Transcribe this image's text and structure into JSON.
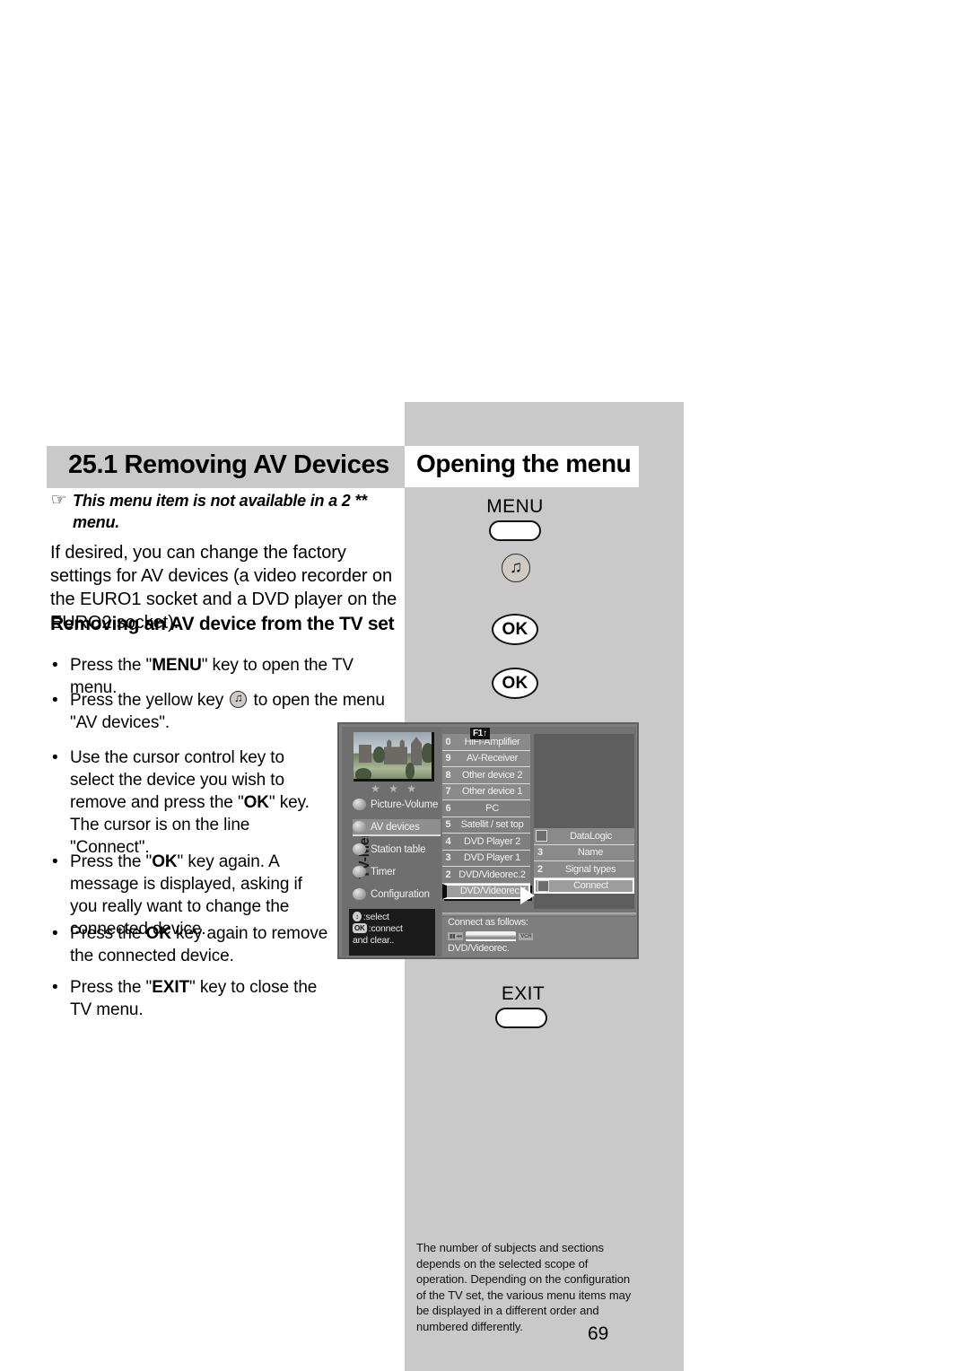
{
  "left": {
    "section_title": "25.1 Removing AV Devices",
    "hand_icon": "☞",
    "note": "This menu item is not available in a 2 ** menu.",
    "paragraph": "If desired, you can change the factory settings for AV devices (a video recorder on the EURO1 socket and a DVD player on the EURO2 socket).",
    "subheading": "Removing an AV device from the TV set",
    "bullets": [
      {
        "pre": "Press the \"",
        "bold": "MENU",
        "post": "\" key to open the TV menu."
      },
      {
        "pre": "Press the yellow key ",
        "bold": "",
        "post": " to open the menu \"AV devices\"."
      },
      {
        "pre": "Use the cursor control key to select the device you wish to remove and press the \"",
        "bold": "OK",
        "post": "\" key. The cursor is on the line \"Connect\"."
      },
      {
        "pre": "Press the \"",
        "bold": "OK",
        "post": "\" key again. A message is displayed, asking if you really want to change the connected device."
      },
      {
        "pre": "Press the ",
        "bold": "OK",
        "post": " key again to remove the connected device."
      },
      {
        "pre": "Press the \"",
        "bold": "EXIT",
        "post": "\" key to close the TV menu."
      }
    ]
  },
  "right": {
    "title": "Opening the menu",
    "menu_key_label": "MENU",
    "yellow_key_icon": "♫",
    "ok_key_1": "OK",
    "ok_key_2": "OK",
    "exit_key_label": "EXIT",
    "footer_note": "The number of subjects and sections depends on the selected scope of operation. Depending on the configuration of the TV set, the various menu items may be displayed in a different order and numbered differently.",
    "page_number": "69"
  },
  "tv_screen": {
    "f1_badge": "F1↑",
    "sidebar_title": "TV-Menu",
    "stars": "★ ★ ★",
    "sidebar_items": [
      {
        "label": "Picture-Volume",
        "selected": false
      },
      {
        "label": "AV devices",
        "selected": true
      },
      {
        "label": "Station table",
        "selected": false
      },
      {
        "label": "Timer",
        "selected": false
      },
      {
        "label": "Configuration",
        "selected": false
      }
    ],
    "help_box": {
      "line1_chip": "↕",
      "line1": ":select",
      "line2_chip": "OK",
      "line2": ":connect",
      "line3": "and clear.."
    },
    "device_list": [
      {
        "num": "0",
        "label": "HiFi-Amplifier",
        "group": 1,
        "selected": false
      },
      {
        "num": "9",
        "label": "AV-Receiver",
        "group": 1,
        "selected": false
      },
      {
        "num": "8",
        "label": "Other device 2",
        "group": 1,
        "selected": false
      },
      {
        "num": "7",
        "label": "Other device 1",
        "group": 1,
        "selected": false
      },
      {
        "num": "6",
        "label": "PC",
        "group": 2,
        "selected": false
      },
      {
        "num": "5",
        "label": "Satellit / set top",
        "group": 2,
        "selected": false
      },
      {
        "num": "4",
        "label": "DVD Player 2",
        "group": 2,
        "selected": false
      },
      {
        "num": "3",
        "label": "DVD Player 1",
        "group": 2,
        "selected": false
      },
      {
        "num": "2",
        "label": "DVD/Videorec.2",
        "group": 2,
        "selected": false
      },
      {
        "num": "",
        "label": "DVD/Videorec.1",
        "group": 2,
        "selected": true
      }
    ],
    "submenu": [
      {
        "num": "",
        "label": "DataLogic",
        "checkbox": true,
        "selected": false
      },
      {
        "num": "3",
        "label": "Name",
        "checkbox": false,
        "selected": false
      },
      {
        "num": "2",
        "label": "Signal types",
        "checkbox": false,
        "selected": false
      },
      {
        "num": "",
        "label": "Connect",
        "checkbox": true,
        "selected": true
      }
    ],
    "bottom": {
      "connect_label": "Connect as follows:",
      "chip_left": "▮▮ ◂◂",
      "chip_right": "VCR",
      "device_name": "DVD/Videorec."
    }
  },
  "colors": {
    "panel_gray": "#c9c9c9",
    "title_gray": "#c9c9c9",
    "tv_bg": "#737373"
  }
}
